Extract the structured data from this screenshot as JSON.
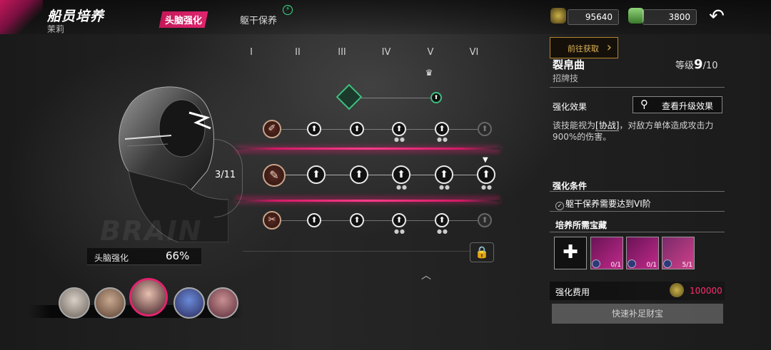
{
  "header": {
    "title": "船员培养",
    "subtitle": "茉莉",
    "tabs": [
      {
        "label": "头脑强化",
        "active": true
      },
      {
        "label": "躯干保养",
        "active": false
      }
    ],
    "resources": [
      {
        "name": "gear-currency",
        "value": "95640"
      },
      {
        "name": "cash-currency",
        "value": "3800"
      }
    ],
    "goto_label": "前往获取"
  },
  "tree": {
    "columns": [
      "I",
      "II",
      "III",
      "IV",
      "V",
      "VI"
    ],
    "progress": "3/11",
    "enhance_label": "头脑强化",
    "enhance_percent": "66%"
  },
  "skill": {
    "name": "裂帛曲",
    "type": "招牌技",
    "level_label": "等级",
    "level_current": "9",
    "level_max": "/10",
    "effect_label": "强化效果",
    "view_upgrade_label": "查看升级效果",
    "desc_before": "该技能视为",
    "desc_keyword": "[协战]",
    "desc_after": "，对敌方单体造成攻击力900%的伤害。",
    "condition_label": "强化条件",
    "condition_text": "躯干保养需要达到VI阶",
    "treasure_label": "培养所需宝藏",
    "treasures": [
      {
        "count": "0/1"
      },
      {
        "count": "0/1"
      },
      {
        "count": "5/1"
      }
    ],
    "cost_label": "强化费用",
    "cost_value": "100000",
    "quick_fill_label": "快速补足财宝"
  },
  "colors": {
    "accent": "#e0246e",
    "cost_insufficient": "#ff2e6e"
  }
}
